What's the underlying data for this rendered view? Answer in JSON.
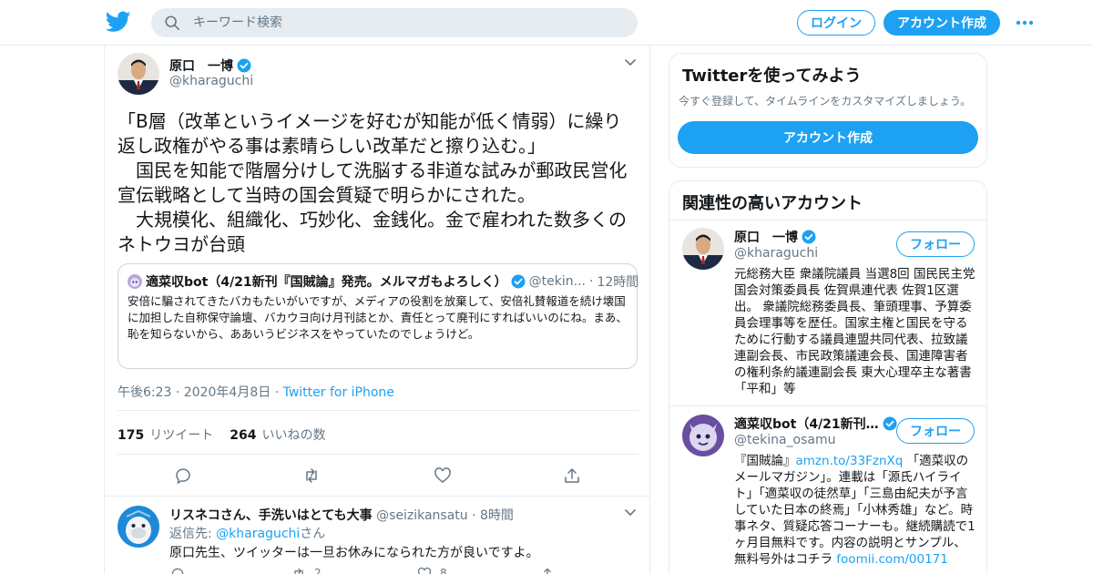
{
  "colors": {
    "accent": "#1da1f2",
    "verified": "#1da1f2",
    "border": "#e6ecf0",
    "muted": "#657786"
  },
  "header": {
    "logo_icon": "twitter-bird-icon",
    "search_placeholder": "キーワード検索",
    "login_label": "ログイン",
    "signup_label": "アカウント作成",
    "more_icon": "more-dots-icon"
  },
  "tweet": {
    "author_name": "原口　一博",
    "author_handle": "@kharaguchi",
    "text": "「B層（改革というイメージを好むが知能が低く情弱）に繰り返し政権がやる事は素晴らしい改革だと擦り込む。」\n　国民を知能で階層分けして洗脳する非道な試みが郵政民営化宣伝戦略として当時の国会質疑で明らかにされた。\n　大規模化、組織化、巧妙化、金銭化。金で雇われた数多くのネトウヨが台頭",
    "quote": {
      "name": "適菜収bot（4/21新刊『国賊論』発売。メルマガもよろしく）",
      "handle": "@tekin...",
      "dot": "·",
      "time": "12時間",
      "text": "安倍に騙されてきたバカもたいがいですが、メディアの役割を放棄して、安倍礼賛報道を続け壊国に加担した自称保守論壇、バカウヨ向け月刊誌とか、責任とって廃刊にすればいいのにね。まあ、恥を知らないから、ああいうビジネスをやっていたのでしょうけど。"
    },
    "time": "午後6:23 · 2020年4月8日",
    "dot": "·",
    "source": "Twitter for iPhone",
    "retweets_count": "175",
    "retweets_label": "リツイート",
    "likes_count": "264",
    "likes_label": "いいねの数"
  },
  "reply": {
    "name": "リスネコさん、手洗いはとても大事",
    "handle": "@seizikansatu",
    "dot": "·",
    "time": "8時間",
    "reply_to_prefix": "返信先: ",
    "reply_to_handle": "@kharaguchi",
    "reply_to_suffix": "さん",
    "text": "原口先生、ツイッターは一旦お休みになられた方が良いですよ。",
    "retweet_count": "2",
    "like_count": "8"
  },
  "sidebar": {
    "signup_card": {
      "title": "Twitterを使ってみよう",
      "subtitle": "今すぐ登録して、タイムラインをカスタマイズしましょう。",
      "button": "アカウント作成"
    },
    "related": {
      "title": "関連性の高いアカウント",
      "accounts": [
        {
          "name": "原口　一博",
          "handle": "@kharaguchi",
          "follow": "フォロー",
          "bio": "元総務大臣 衆議院議員 当選8回 国民民主党国会対策委員長 佐賀県連代表 佐賀1区選出。 衆議院総務委員長、筆頭理事、予算委員会理事等を歴任。国家主権と国民を守るために行動する議員連盟共同代表、拉致議連副会長、市民政策議連会長、国連障害者の権利条約議連副会長 東大心理卒主な著書「平和」等"
        },
        {
          "name": "適菜収bot（4/21新刊…",
          "handle": "@tekina_osamu",
          "follow": "フォロー",
          "bio_prefix": "『国賊論』",
          "bio_link": "amzn.to/33FznXq",
          "bio_rest": " 「適菜収のメールマガジン」。連載は「源氏ハイライト」「適菜収の徒然草」「三島由紀夫が予言していた日本の終焉」「小林秀雄」など。時事ネタ、質疑応答コーナーも。継続購読で1ヶ月目無料です。内容の説明とサンプル、無料号外はコチラ ",
          "bio_link2": "foomii.com/00171"
        }
      ]
    }
  }
}
